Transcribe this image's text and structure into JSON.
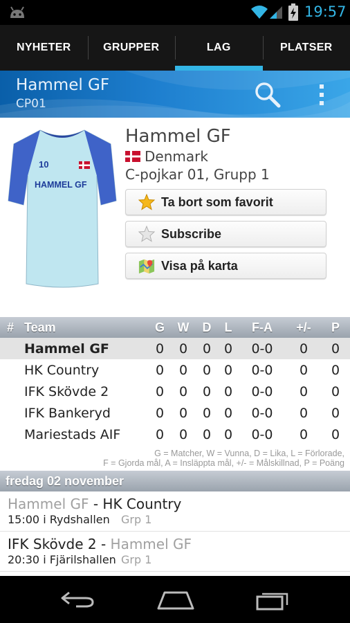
{
  "status_bar": {
    "time": "19:57",
    "icons": [
      "android-icon",
      "wifi-icon",
      "signal-icon",
      "battery-charging-icon"
    ]
  },
  "tabs": [
    {
      "label": "NYHETER",
      "active": false
    },
    {
      "label": "GRUPPER",
      "active": false
    },
    {
      "label": "LAG",
      "active": true
    },
    {
      "label": "PLATSER",
      "active": false
    }
  ],
  "action_bar": {
    "title": "Hammel GF",
    "subtitle": "CP01",
    "icons": [
      "search-icon",
      "overflow-menu-icon"
    ]
  },
  "team": {
    "name": "Hammel GF",
    "country": "Denmark",
    "group_line": "C-pojkar 01, Grupp 1",
    "jersey": {
      "number": "10",
      "text": "HAMMEL GF"
    }
  },
  "buttons": {
    "favorite": "Ta bort som favorit",
    "subscribe": "Subscribe",
    "map": "Visa på karta"
  },
  "standings": {
    "headers": {
      "num": "#",
      "team": "Team",
      "g": "G",
      "w": "W",
      "d": "D",
      "l": "L",
      "fa": "F-A",
      "pm": "+/-",
      "p": "P"
    },
    "rows": [
      {
        "num": "",
        "team": "Hammel GF",
        "g": "0",
        "w": "0",
        "d": "0",
        "l": "0",
        "fa": "0-0",
        "pm": "0",
        "p": "0"
      },
      {
        "num": "",
        "team": "HK Country",
        "g": "0",
        "w": "0",
        "d": "0",
        "l": "0",
        "fa": "0-0",
        "pm": "0",
        "p": "0"
      },
      {
        "num": "",
        "team": "IFK Skövde 2",
        "g": "0",
        "w": "0",
        "d": "0",
        "l": "0",
        "fa": "0-0",
        "pm": "0",
        "p": "0"
      },
      {
        "num": "",
        "team": "IFK Bankeryd",
        "g": "0",
        "w": "0",
        "d": "0",
        "l": "0",
        "fa": "0-0",
        "pm": "0",
        "p": "0"
      },
      {
        "num": "",
        "team": "Mariestads AIF",
        "g": "0",
        "w": "0",
        "d": "0",
        "l": "0",
        "fa": "0-0",
        "pm": "0",
        "p": "0"
      }
    ],
    "legend_line1": "G = Matcher, W = Vunna, D = Lika, L = Förlorade,",
    "legend_line2": "F = Gjorda mål, A = Insläppta mål, +/- = Målskillnad, P = Poäng"
  },
  "schedule": {
    "date_header": "fredag 02 november",
    "matches": [
      {
        "home": "Hammel GF",
        "separator": " - ",
        "away": "HK Country",
        "when": "15:00 i Rydshallen",
        "group": "Grp 1"
      },
      {
        "home": "IFK Skövde 2",
        "separator": " - ",
        "away": "Hammel GF",
        "when": "20:30 i Fjärilshallen",
        "group": "Grp 1"
      }
    ]
  },
  "nav_bar": {
    "icons": [
      "back-icon",
      "home-icon",
      "recent-apps-icon"
    ]
  },
  "colors": {
    "accent": "#33b5e5",
    "action_bar_dark": "#0a5fa9",
    "action_bar_light": "#3aa6e8",
    "table_header": "#9aa3ad"
  }
}
